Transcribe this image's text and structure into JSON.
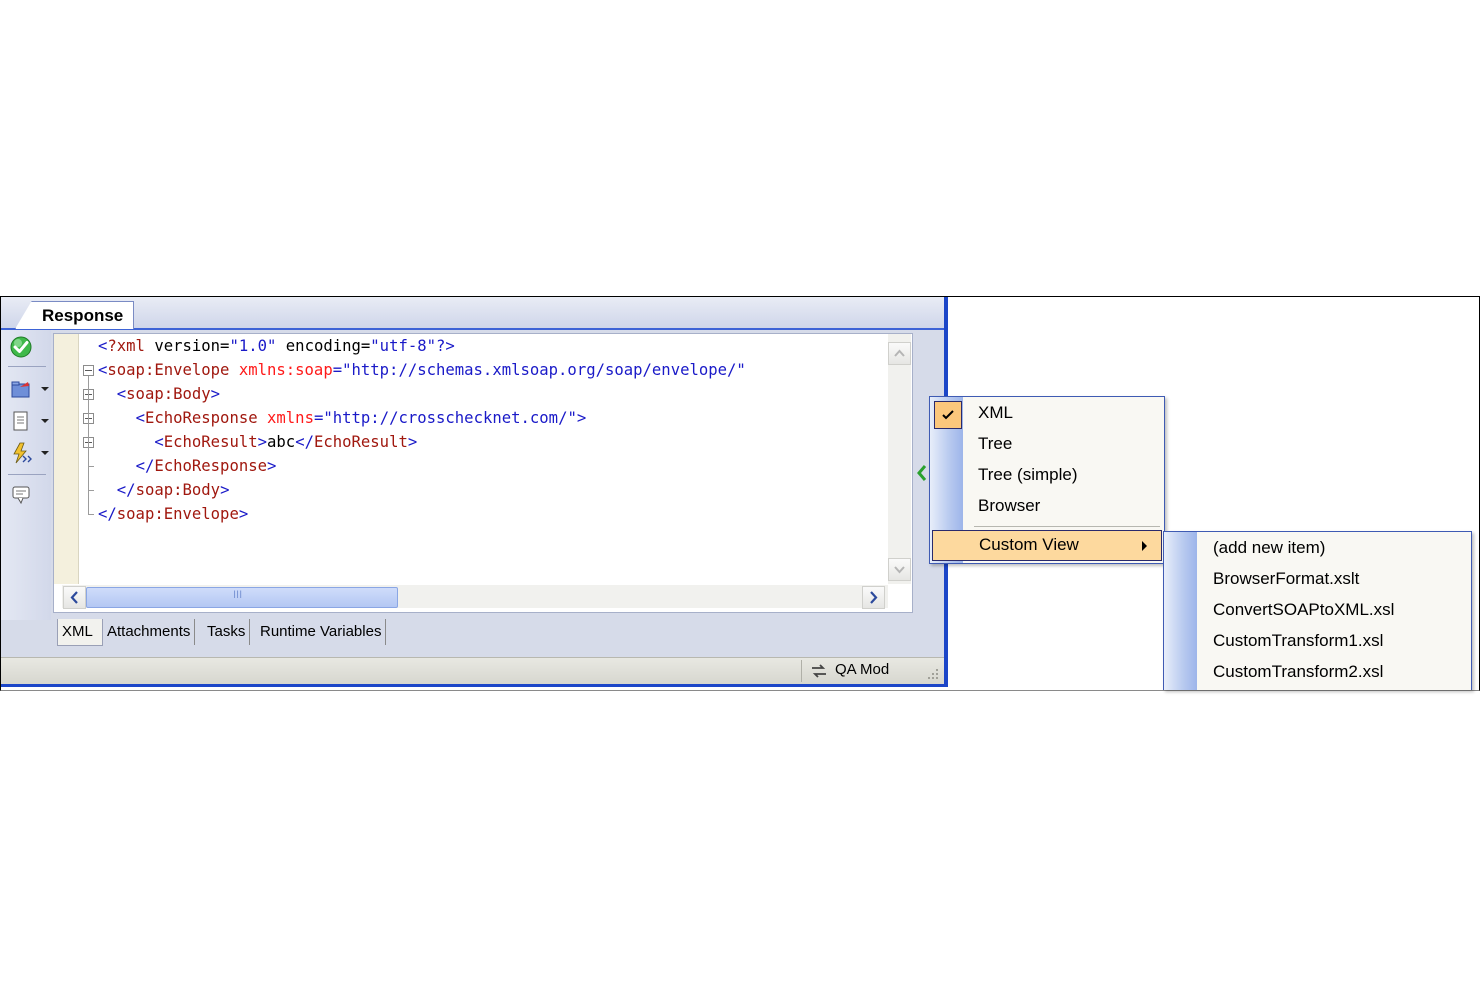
{
  "panel": {
    "tab_title": "Response"
  },
  "toolbar": {
    "buttons": [
      "check-icon",
      "open-folder-icon",
      "document-icon",
      "lightning-icon",
      "comment-icon"
    ]
  },
  "editor": {
    "lines": [
      {
        "parts": [
          [
            "br",
            "<"
          ],
          [
            "tag",
            "?xml"
          ],
          [
            "txt",
            " version="
          ],
          [
            "val",
            "\"1.0\""
          ],
          [
            "txt",
            " encoding="
          ],
          [
            "val",
            "\"utf-8\""
          ],
          [
            "br",
            "?>"
          ]
        ]
      },
      {
        "parts": [
          [
            "br",
            "<"
          ],
          [
            "tag",
            "soap:Envelope "
          ],
          [
            "attr",
            "xmlns:soap"
          ],
          [
            "br",
            "="
          ],
          [
            "val",
            "\"http://schemas.xmlsoap.org/soap/envelope/\""
          ]
        ]
      },
      {
        "parts": [
          [
            "txt",
            "  "
          ],
          [
            "br",
            "<"
          ],
          [
            "tag",
            "soap:Body"
          ],
          [
            "br",
            ">"
          ]
        ]
      },
      {
        "parts": [
          [
            "txt",
            "    "
          ],
          [
            "br",
            "<"
          ],
          [
            "tag",
            "EchoResponse "
          ],
          [
            "attr",
            "xmlns"
          ],
          [
            "br",
            "="
          ],
          [
            "val",
            "\"http://crosschecknet.com/\""
          ],
          [
            "br",
            ">"
          ]
        ]
      },
      {
        "parts": [
          [
            "txt",
            "      "
          ],
          [
            "br",
            "<"
          ],
          [
            "tag",
            "EchoResult"
          ],
          [
            "br",
            ">"
          ],
          [
            "txt",
            "abc"
          ],
          [
            "br",
            "</"
          ],
          [
            "tag",
            "EchoResult"
          ],
          [
            "br",
            ">"
          ]
        ]
      },
      {
        "parts": [
          [
            "txt",
            "    "
          ],
          [
            "br",
            "</"
          ],
          [
            "tag",
            "EchoResponse"
          ],
          [
            "br",
            ">"
          ]
        ]
      },
      {
        "parts": [
          [
            "txt",
            "  "
          ],
          [
            "br",
            "</"
          ],
          [
            "tag",
            "soap:Body"
          ],
          [
            "br",
            ">"
          ]
        ]
      },
      {
        "parts": [
          [
            "br",
            "</"
          ],
          [
            "tag",
            "soap:Envelope"
          ],
          [
            "br",
            ">"
          ]
        ]
      }
    ],
    "hscroll_thumb_glyph": "III"
  },
  "bottom_tabs": [
    {
      "label": "XML",
      "active": true
    },
    {
      "label": "Attachments",
      "active": false
    },
    {
      "label": "Tasks",
      "active": false
    },
    {
      "label": "Runtime Variables",
      "active": false
    }
  ],
  "status": {
    "mode_label": "QA Mod"
  },
  "context_menu": {
    "items": [
      {
        "label": "XML",
        "checked": true
      },
      {
        "label": "Tree",
        "checked": false
      },
      {
        "label": "Tree (simple)",
        "checked": false
      },
      {
        "label": "Browser",
        "checked": false
      }
    ],
    "submenu_parent": "Custom View",
    "submenu_items": [
      "(add new item)",
      "BrowserFormat.xslt",
      "ConvertSOAPtoXML.xsl",
      "CustomTransform1.xsl",
      "CustomTransform2.xsl"
    ]
  },
  "colors": {
    "accent_blue": "#1c46c8",
    "menu_highlight": "#fdd99e",
    "tag": "#a0180f",
    "attribute": "#ff1a1a",
    "value": "#1a1ac8"
  }
}
